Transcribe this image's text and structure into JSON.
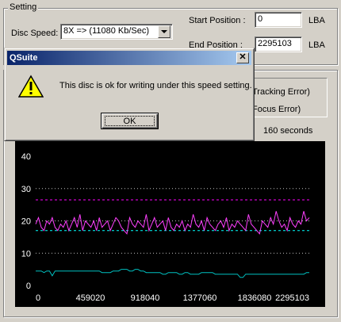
{
  "setting": {
    "legend": "Setting",
    "disc_speed_label": "Disc Speed:",
    "disc_speed_value": "8X => (11080 Kb/Sec)",
    "start_position_label": "Start Position :",
    "start_position_value": "0",
    "end_position_label": "End Position :",
    "end_position_value": "2295103",
    "unit_label": "LBA"
  },
  "legend_panel": {
    "tracking_error": "Tracking Error)",
    "focus_error": "Focus Error)"
  },
  "time_label": "160 seconds",
  "dialog": {
    "title": "QSuite",
    "close_glyph": "✕",
    "message": "This disc is ok for writing under this speed setting.",
    "ok_label": "OK",
    "icon": "warning-icon"
  },
  "chart_data": {
    "type": "line",
    "x_ticks": [
      "0",
      "459020",
      "918040",
      "1377060",
      "1836080",
      "2295103"
    ],
    "y_ticks": [
      "0",
      "10",
      "20",
      "30",
      "40"
    ],
    "xlim": [
      0,
      2295103
    ],
    "ylim": [
      0,
      40
    ],
    "grid": "dotted horizontal at 10, 20, 30",
    "thresholds": [
      {
        "value": 26.5,
        "color": "#ff00ff",
        "style": "dashed"
      },
      {
        "value": 17,
        "color": "#00ffff",
        "style": "dashed"
      }
    ],
    "series": [
      {
        "color": "#ff40ff",
        "values": [
          19,
          21,
          18,
          17,
          20,
          19,
          21,
          18,
          17,
          19,
          18,
          20,
          17,
          19,
          21,
          18,
          22,
          17,
          20,
          19,
          18,
          20,
          17,
          21,
          18,
          19,
          20,
          17,
          19,
          21,
          20,
          18,
          17,
          16,
          21,
          19,
          18,
          20,
          19,
          18,
          22,
          17,
          19,
          21,
          18,
          19,
          20,
          17,
          21,
          18,
          17,
          19,
          18,
          20,
          17,
          19,
          18,
          22,
          19,
          18,
          20,
          17,
          21,
          19,
          18,
          17,
          19,
          20,
          18,
          21,
          17,
          19,
          18,
          20,
          19,
          18,
          17,
          22,
          19,
          18,
          17,
          16,
          20,
          19,
          18,
          21,
          19,
          23,
          20,
          18,
          19,
          17,
          21,
          19,
          18,
          20,
          19,
          23,
          20,
          21
        ]
      },
      {
        "color": "#00c0c0",
        "values": [
          4.5,
          4.5,
          4.5,
          4,
          4.5,
          4.5,
          3,
          4.5,
          4.5,
          4.5,
          4.5,
          4.5,
          4.5,
          4.5,
          4.5,
          4.5,
          4.5,
          4.5,
          4.5,
          4.5,
          4.5,
          4.5,
          4.5,
          4.5,
          4,
          4,
          4,
          4,
          4.5,
          4.5,
          4.5,
          5,
          5,
          5,
          4.5,
          4.5,
          5,
          5,
          4.5,
          4.5,
          4,
          4,
          4,
          4,
          4,
          4,
          3.5,
          3.5,
          4,
          4,
          4,
          4,
          3.5,
          3.5,
          4,
          4,
          3.5,
          3.5,
          3.5,
          3.5,
          4,
          4,
          4,
          4,
          4,
          3.5,
          3.5,
          3.5,
          3.5,
          3.5,
          3.5,
          3.5,
          3.5,
          3.5,
          2.5,
          2.5,
          3.5,
          3.5,
          3.5,
          3.5,
          3.5,
          3.5,
          3.5,
          3.5,
          3.5,
          3.5,
          3.5,
          3.5,
          3.5,
          3.5,
          3.5,
          3.5,
          3.5,
          3.5,
          3.5,
          3.5,
          3.5,
          3.5,
          4,
          4
        ]
      }
    ]
  }
}
